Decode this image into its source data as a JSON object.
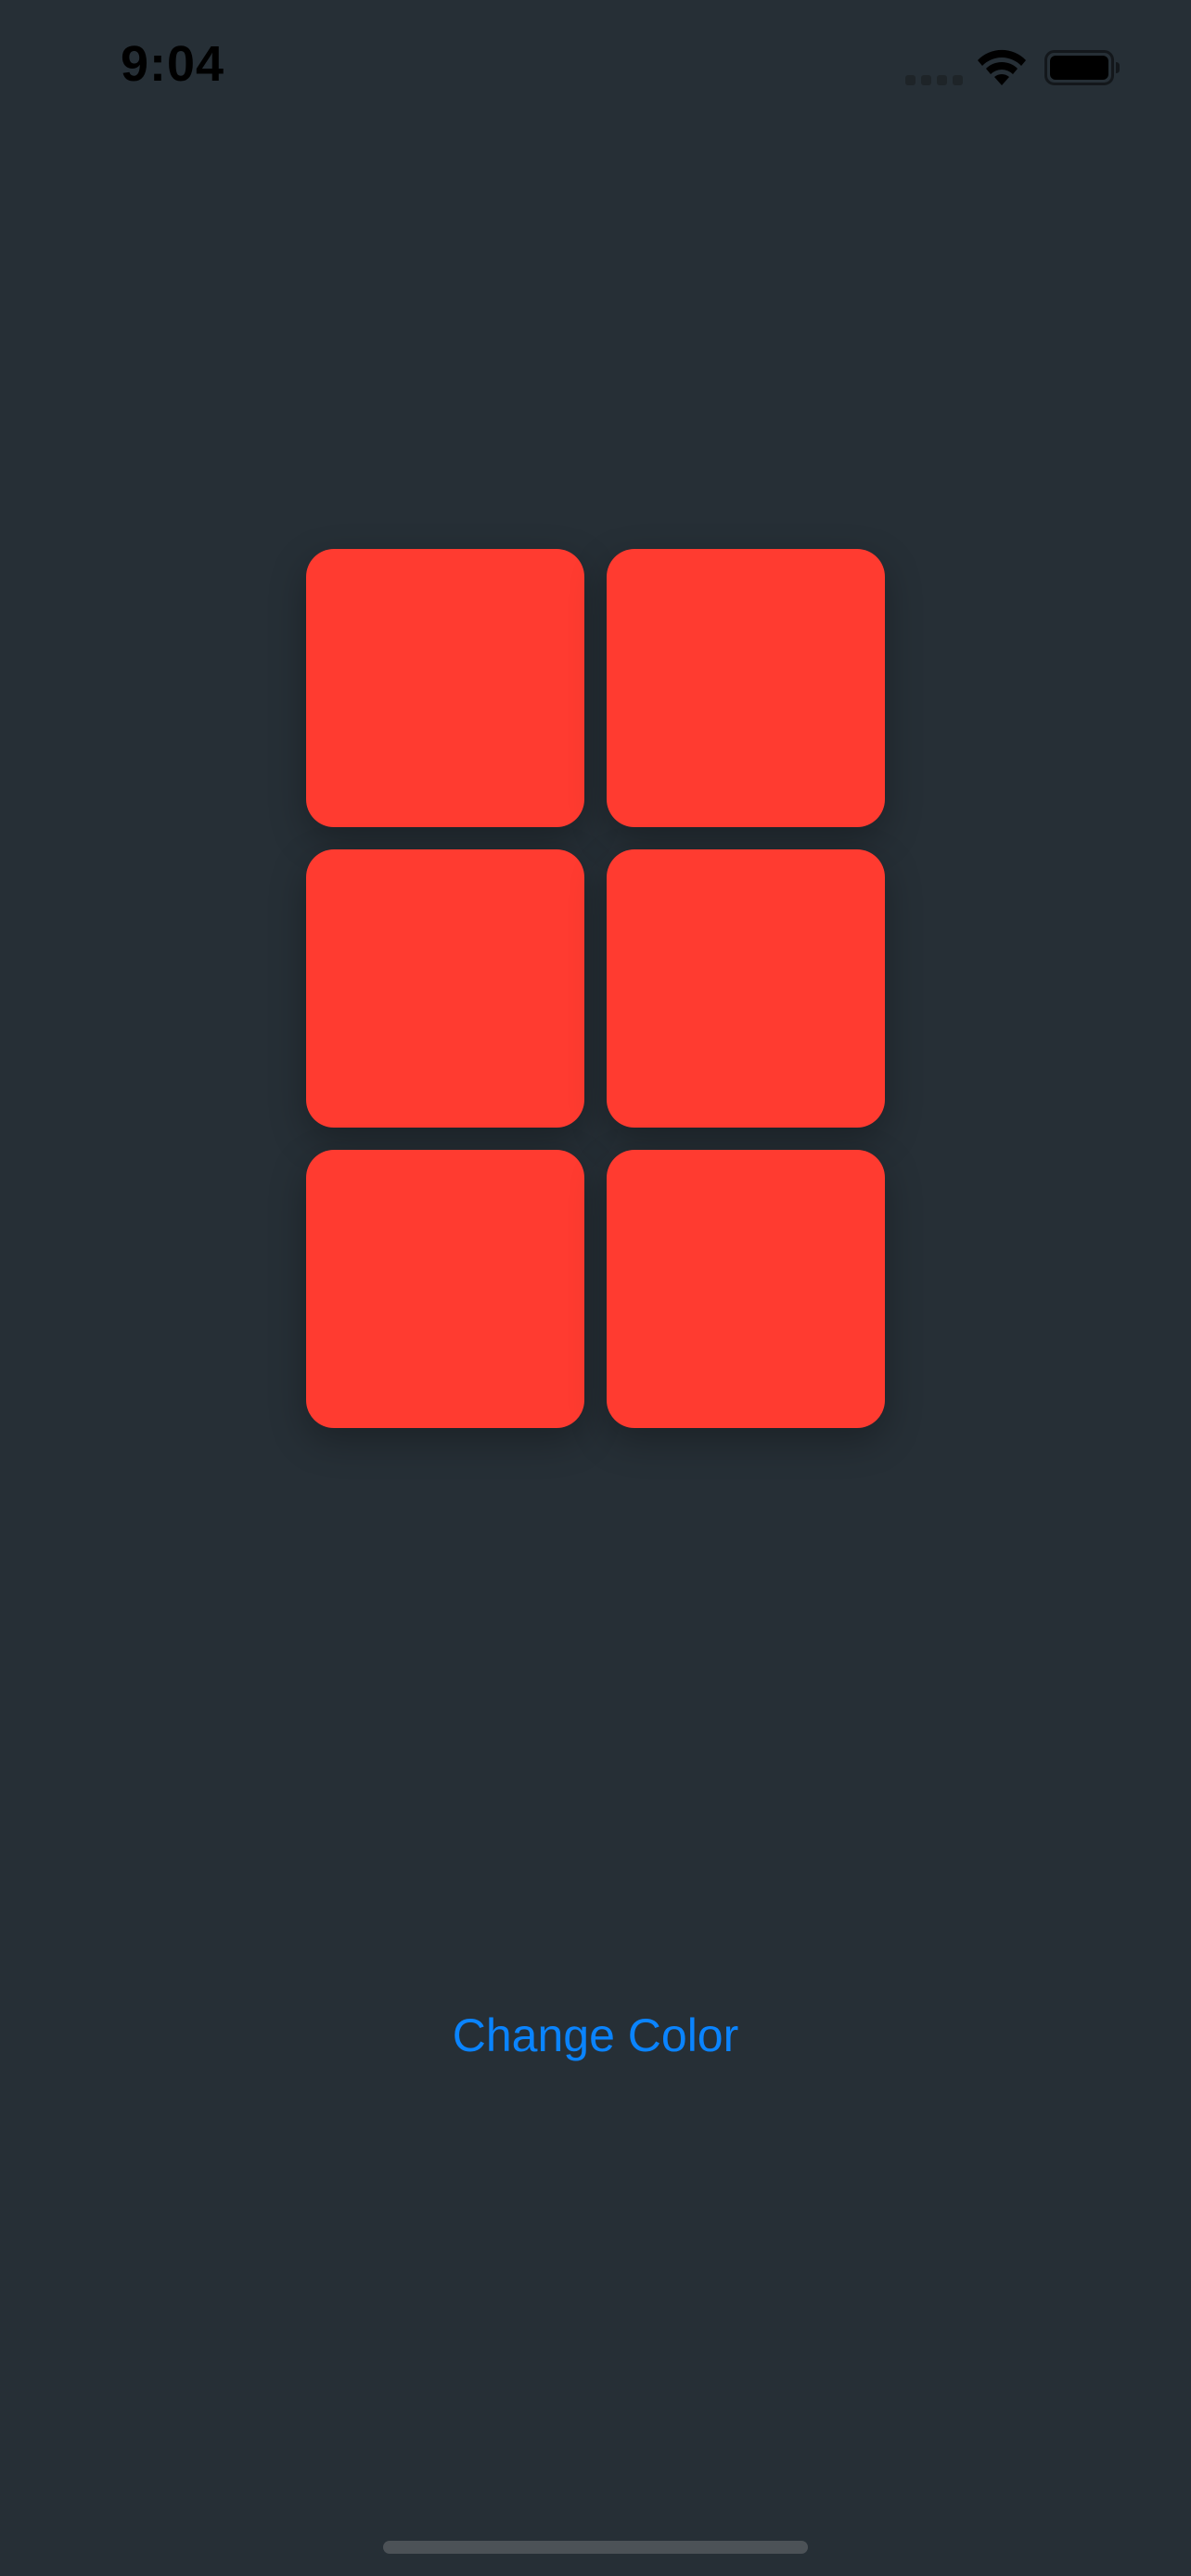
{
  "status_bar": {
    "time": "9:04",
    "signal_icon": "signal-bars-icon",
    "wifi_icon": "wifi-icon",
    "battery_icon": "battery-icon",
    "battery_level": 1.0
  },
  "grid": {
    "rows": 3,
    "columns": 2,
    "tile_color": "#FF3B30"
  },
  "change_color_button": {
    "label": "Change Color",
    "color": "#0A84FF"
  },
  "colors": {
    "background": "#262F36",
    "status_text": "#000000",
    "home_indicator": "#4C5257"
  }
}
